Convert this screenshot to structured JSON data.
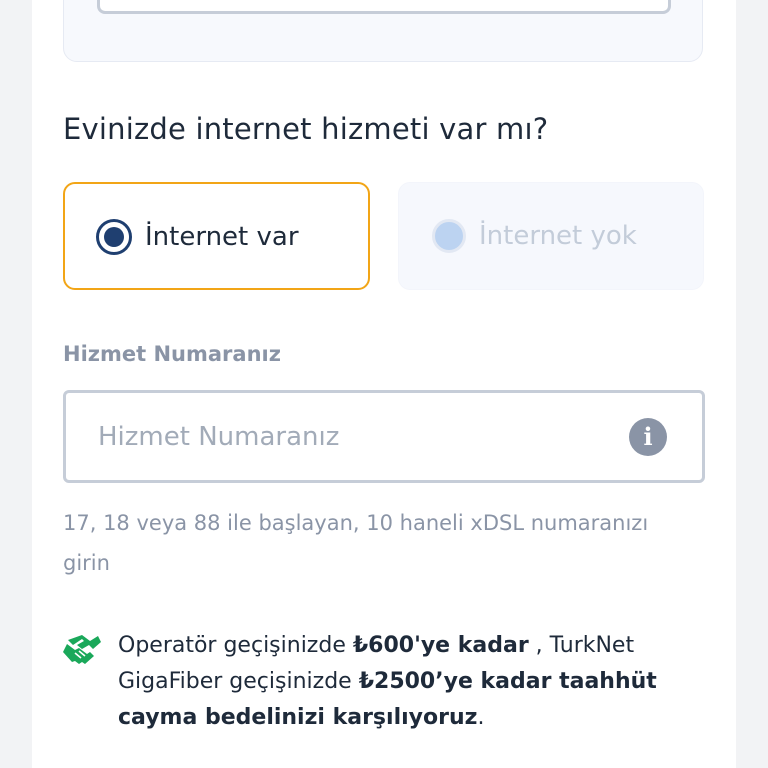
{
  "question": "Evinizde internet hizmeti var mı?",
  "options": [
    {
      "label": "İnternet var",
      "selected": true
    },
    {
      "label": "İnternet yok",
      "selected": false
    }
  ],
  "service_number": {
    "label": "Hizmet Numaranız",
    "placeholder": "Hizmet Numaranız",
    "value": "",
    "info_icon": "i",
    "hint": "17, 18 veya 88 ile başlayan, 10 haneli xDSL numaranızı girin"
  },
  "promo": {
    "icon": "handshake-icon",
    "part1": "Operatör geçişinizde ",
    "bold1": "₺600'ye kadar",
    "part2": " , TurkNet GigaFiber geçişinizde ",
    "bold2": "₺2500’ye kadar taahhüt cayma bedelinizi karşılıyoruz",
    "part3": "."
  },
  "colors": {
    "selected_border": "#f2a516",
    "radio_primary": "#1f3f70",
    "promo_icon": "#1aa85a"
  }
}
